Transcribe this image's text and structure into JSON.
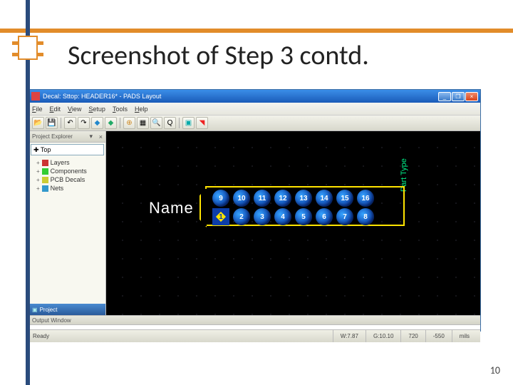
{
  "slide": {
    "title": "Screenshot of Step 3 contd.",
    "page_number": "10"
  },
  "app": {
    "title": "Decal: Sttop: HEADER16* - PADS Layout",
    "menu": {
      "file": "File",
      "edit": "Edit",
      "view": "View",
      "setup": "Setup",
      "tools": "Tools",
      "help": "Help"
    },
    "sidebar": {
      "header": "Project Explorer",
      "combo": "✚ Top",
      "items": [
        "Layers",
        "Components",
        "PCB Decals",
        "Nets"
      ],
      "tab": "Project"
    },
    "canvas": {
      "name_label": "Name",
      "part_type": "Part Type",
      "pins_top": [
        "16",
        "15",
        "14",
        "13",
        "12",
        "11",
        "10",
        "9"
      ],
      "pins_bottom": [
        "1",
        "2",
        "3",
        "4",
        "5",
        "6",
        "7",
        "8"
      ]
    },
    "output": {
      "header": "Output Window"
    },
    "status": {
      "ready": "Ready",
      "w": "W:7.87",
      "g": "G:10.10",
      "x": "720",
      "y": "-550",
      "unit": "mils"
    }
  }
}
